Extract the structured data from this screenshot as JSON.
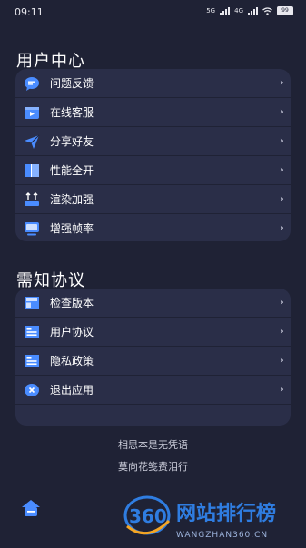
{
  "status": {
    "time": "09:11",
    "net1": "5G",
    "net2": "4G",
    "battery": "99"
  },
  "sections": [
    {
      "title": "用户中心",
      "items": [
        {
          "label": "问题反馈",
          "icon": "chat-bubble-icon"
        },
        {
          "label": "在线客服",
          "icon": "video-chat-icon"
        },
        {
          "label": "分享好友",
          "icon": "paper-plane-icon"
        },
        {
          "label": "性能全开",
          "icon": "book-icon"
        },
        {
          "label": "渲染加强",
          "icon": "upload-tray-icon"
        },
        {
          "label": "增强帧率",
          "icon": "monitor-icon"
        }
      ]
    },
    {
      "title": "需知协议",
      "items": [
        {
          "label": "检查版本",
          "icon": "layout-icon"
        },
        {
          "label": "用户协议",
          "icon": "document-icon"
        },
        {
          "label": "隐私政策",
          "icon": "document-icon"
        },
        {
          "label": "退出应用",
          "icon": "close-circle-icon"
        }
      ]
    }
  ],
  "chevron": "›",
  "footer": {
    "line1": "相思本是无凭语",
    "line2": "莫向花笺费泪行"
  },
  "watermark": {
    "logo": "360",
    "title": "网站排行榜",
    "subtitle": "WANGZHAN360.CN"
  },
  "colors": {
    "background": "#1f2235",
    "card": "#2a2e48",
    "accent": "#4a8cff",
    "watermark": "#2f7de1"
  }
}
